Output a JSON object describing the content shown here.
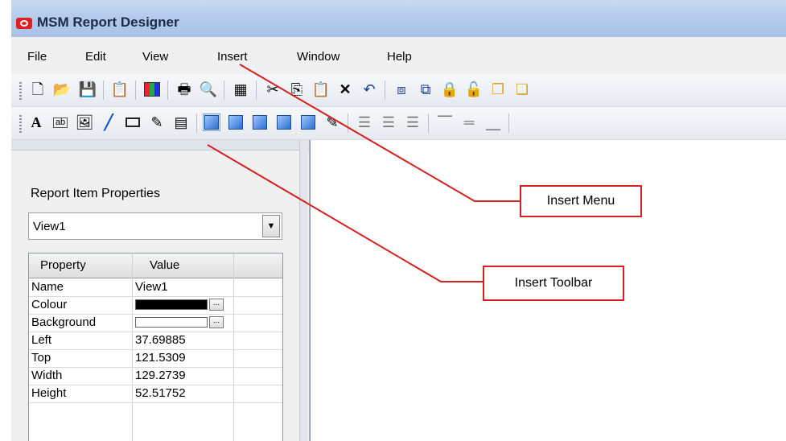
{
  "app": {
    "title": "MSM Report Designer"
  },
  "menu": [
    "File",
    "Edit",
    "View",
    "Insert",
    "Window",
    "Help"
  ],
  "toolbar_main": [
    "new-file-icon",
    "open-folder-icon",
    "save-icon",
    "properties-icon",
    "color-palette-icon",
    "print-icon",
    "print-preview-icon",
    "report-settings-icon",
    "cut-icon",
    "copy-icon",
    "paste-icon",
    "delete-icon",
    "undo-icon",
    "select-frame-icon",
    "resize-frame-icon",
    "lock-icon",
    "unlock-icon",
    "bring-to-front-icon"
  ],
  "toolbar_insert": [
    "text-icon",
    "textbox-icon",
    "image-icon",
    "line-icon",
    "rectangle-icon",
    "pen-icon",
    "table-icon",
    "view-3d-icon",
    "align-left-icon",
    "align-center-icon",
    "align-right-icon",
    "align-top-icon",
    "align-middle-icon",
    "align-bottom-icon"
  ],
  "properties": {
    "title": "Report Item Properties",
    "selected_item": "View1",
    "headers": {
      "property": "Property",
      "value": "Value"
    },
    "rows": [
      {
        "name": "Name",
        "value": "View1"
      },
      {
        "name": "Colour",
        "value": "",
        "swatch": "#000000"
      },
      {
        "name": "Background",
        "value": "",
        "swatch": "#ffffff"
      },
      {
        "name": "Left",
        "value": "37.69885"
      },
      {
        "name": "Top",
        "value": "121.5309"
      },
      {
        "name": "Width",
        "value": "129.2739"
      },
      {
        "name": "Height",
        "value": "52.51752"
      }
    ],
    "ellipsis": "..."
  },
  "callouts": {
    "insert_menu": "Insert Menu",
    "insert_toolbar": "Insert Toolbar"
  },
  "colors": {
    "callout": "#d62020",
    "title_bar": "#b4cbea"
  }
}
